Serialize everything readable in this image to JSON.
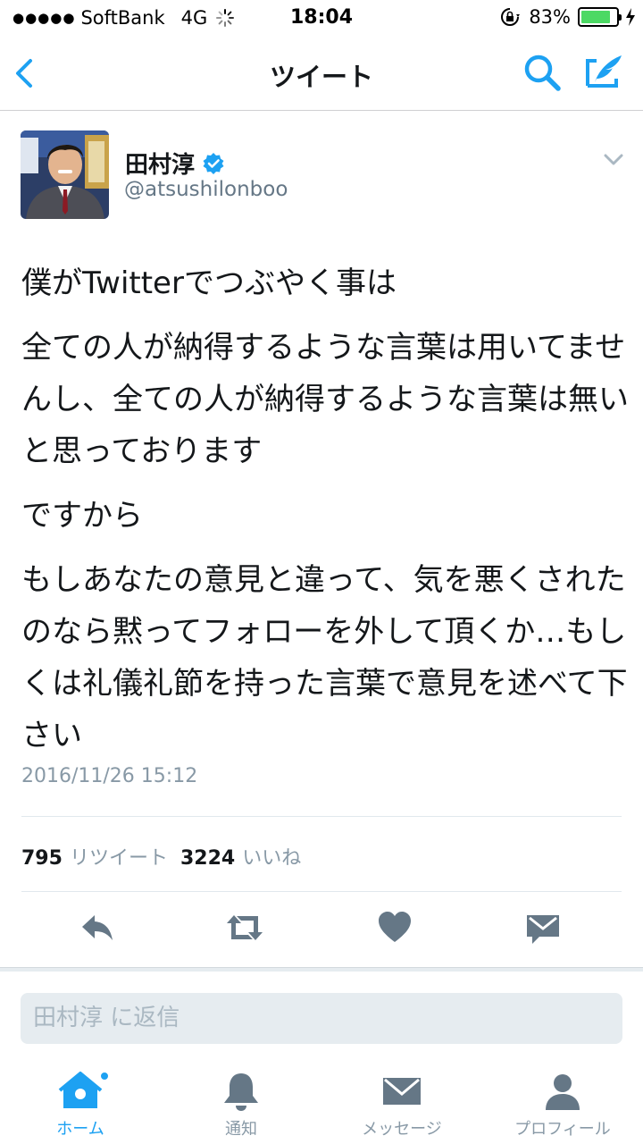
{
  "status_bar": {
    "carrier": "SoftBank",
    "network": "4G",
    "time": "18:04",
    "battery": "83%",
    "battery_level": 0.83,
    "battery_color": "#4cd964"
  },
  "nav": {
    "title": "ツイート",
    "back_icon": "chevron-left-icon",
    "search_icon": "search-icon",
    "compose_icon": "compose-icon",
    "accent": "#1da1f2"
  },
  "tweet": {
    "author_name": "田村淳",
    "handle": "@atsushilonboo",
    "verified": true,
    "paragraphs": [
      "僕がTwitterでつぶやく事は",
      "全ての人が納得するような言葉は用いてませんし、全ての人が納得するような言葉は無いと思っております",
      "ですから",
      "もしあなたの意見と違って、気を悪くされたのなら黙ってフォローを外して頂くか…もしくは礼儀礼節を持った言葉で意見を述べて下さい"
    ],
    "timestamp": "2016/11/26 15:12",
    "retweet_count": "795",
    "retweet_label": "リツイート",
    "like_count": "3224",
    "like_label": "いいね",
    "actions": [
      "reply-icon",
      "retweet-icon",
      "heart-icon",
      "dm-icon"
    ]
  },
  "reply": {
    "placeholder": "田村淳 に返信"
  },
  "tabbar": {
    "items": [
      {
        "label": "ホーム",
        "icon": "home-icon",
        "active": true
      },
      {
        "label": "通知",
        "icon": "bell-icon",
        "active": false
      },
      {
        "label": "メッセージ",
        "icon": "envelope-icon",
        "active": false
      },
      {
        "label": "プロフィール",
        "icon": "person-icon",
        "active": false
      }
    ]
  }
}
